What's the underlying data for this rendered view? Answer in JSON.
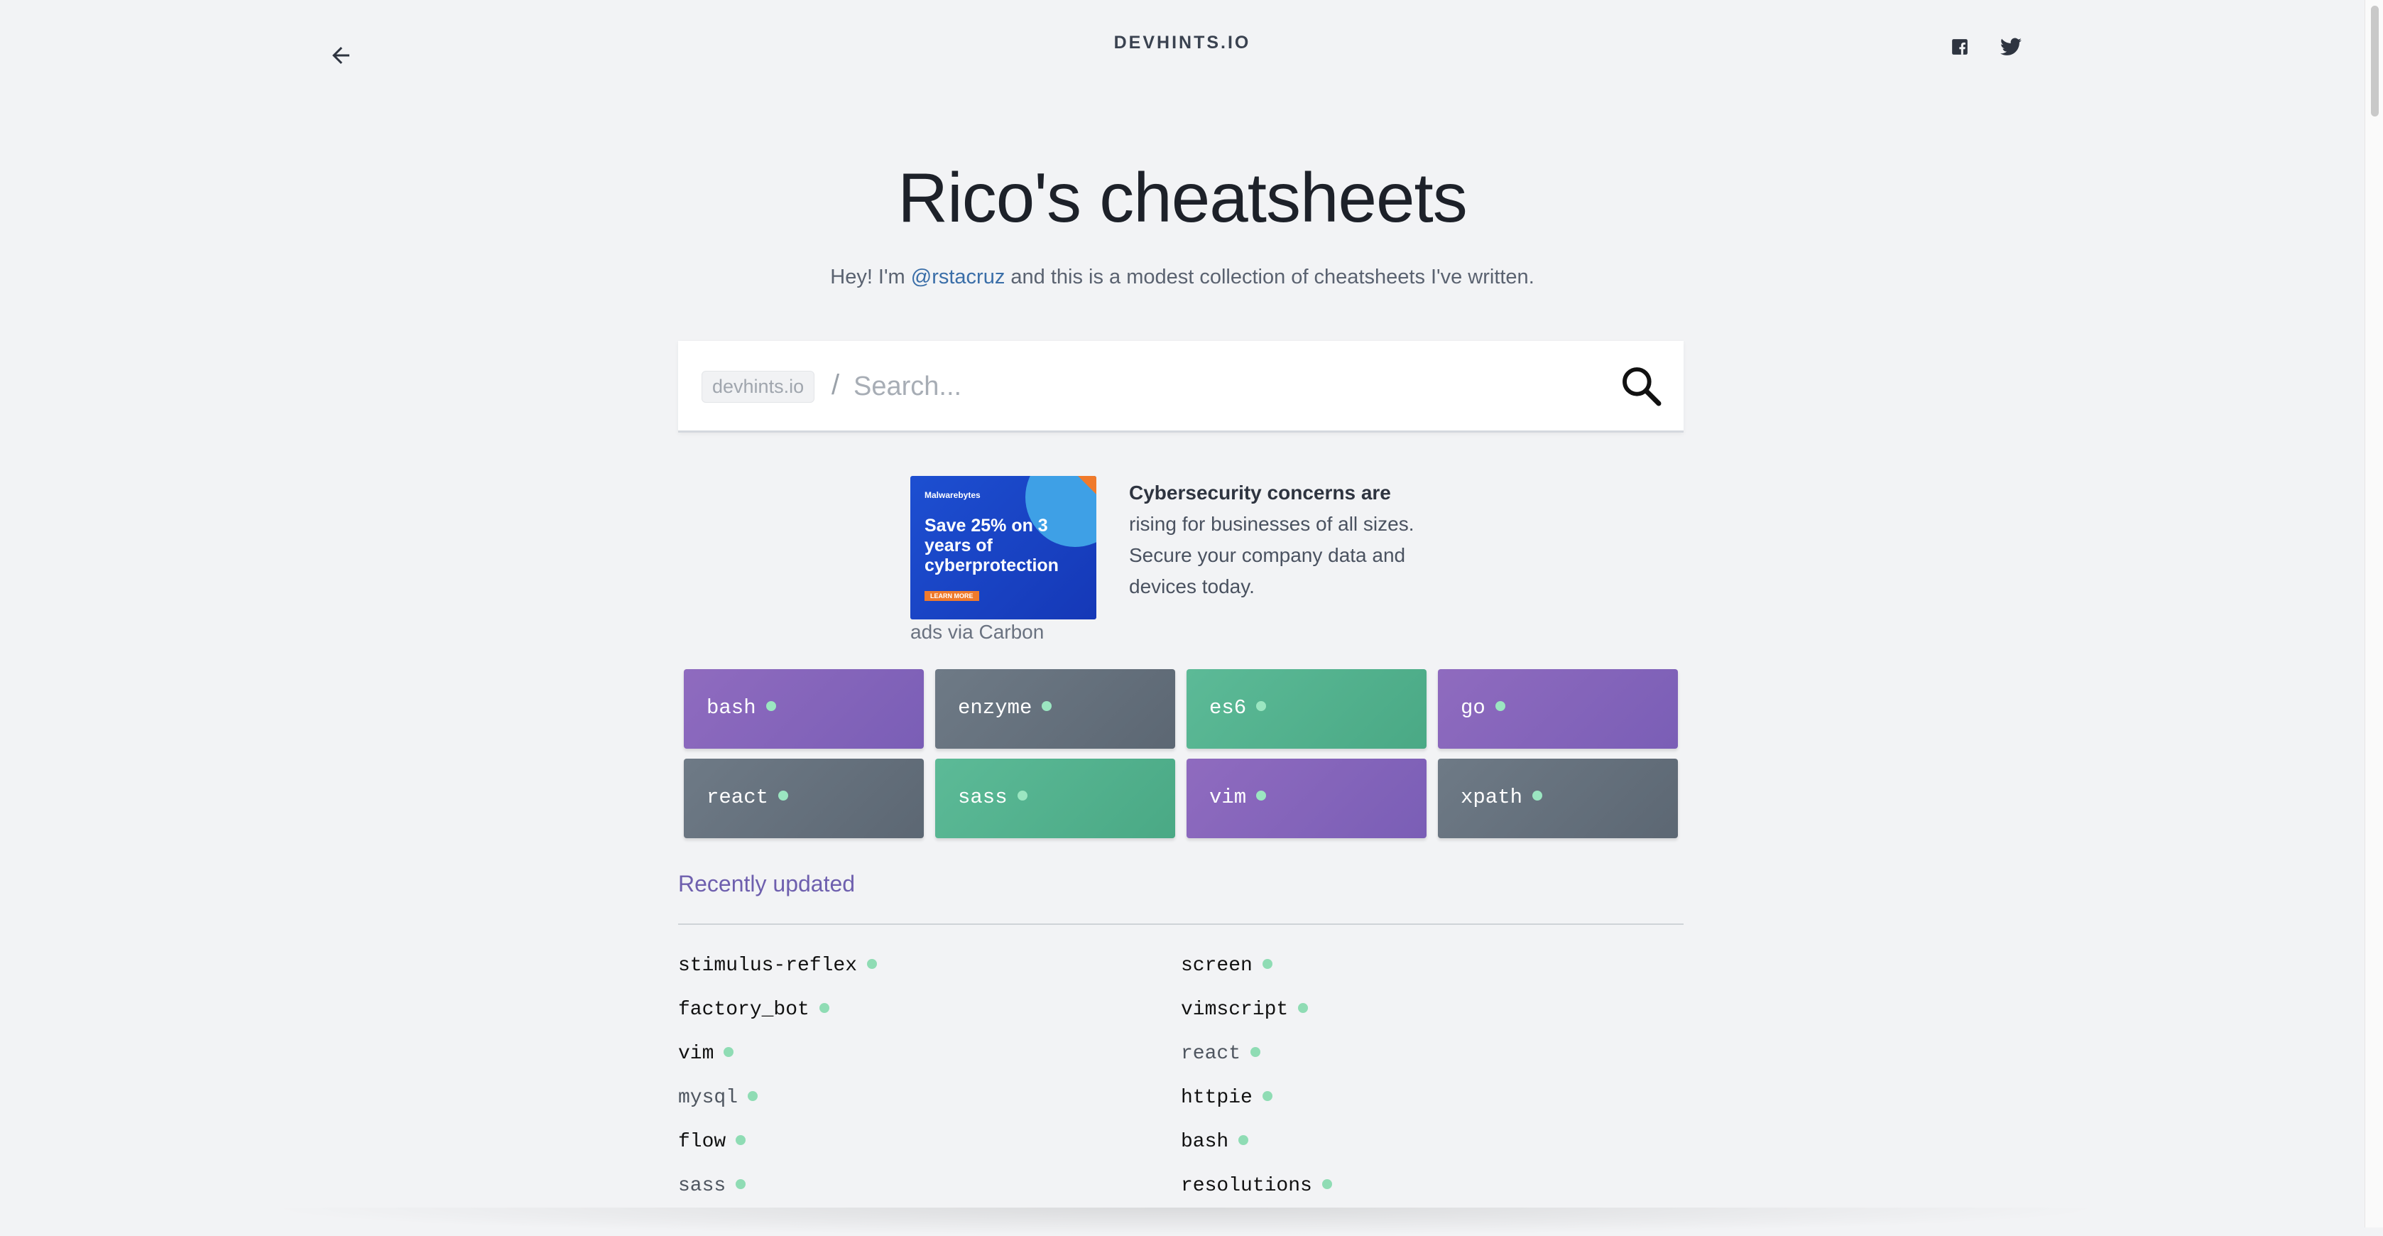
{
  "header": {
    "brand": "DEVHINTS.IO",
    "back_icon": "arrow-left-icon",
    "social": [
      {
        "name": "facebook",
        "icon": "facebook-icon"
      },
      {
        "name": "twitter",
        "icon": "twitter-icon"
      }
    ]
  },
  "hero": {
    "title": "Rico's cheatsheets",
    "sub_before": "Hey! I'm ",
    "sub_link": "@rstacruz",
    "sub_after": " and this is a modest collection of cheatsheets I've written."
  },
  "search": {
    "prefix": "devhints.io",
    "slash": "/",
    "placeholder": "Search...",
    "value": ""
  },
  "ad": {
    "brand": "Malwarebytes",
    "headline": "Save 25% on 3 years of cyberprotection",
    "cta": "LEARN MORE",
    "text_bold": "Cybersecurity concerns are",
    "text_rest": " rising for businesses of all sizes. Secure your company data and devices today.",
    "via": "ads via Carbon"
  },
  "tiles": [
    {
      "label": "bash",
      "color": "purple"
    },
    {
      "label": "enzyme",
      "color": "slate"
    },
    {
      "label": "es6",
      "color": "teal"
    },
    {
      "label": "go",
      "color": "purple"
    },
    {
      "label": "react",
      "color": "slate"
    },
    {
      "label": "sass",
      "color": "teal"
    },
    {
      "label": "vim",
      "color": "purple"
    },
    {
      "label": "xpath",
      "color": "slate"
    }
  ],
  "recent": {
    "title": "Recently updated",
    "left": [
      {
        "label": "stimulus-reflex",
        "muted": false
      },
      {
        "label": "factory_bot",
        "muted": false
      },
      {
        "label": "vim",
        "muted": false
      },
      {
        "label": "mysql",
        "muted": true
      },
      {
        "label": "flow",
        "muted": false
      },
      {
        "label": "sass",
        "muted": true
      }
    ],
    "right": [
      {
        "label": "screen",
        "muted": false
      },
      {
        "label": "vimscript",
        "muted": false
      },
      {
        "label": "react",
        "muted": true
      },
      {
        "label": "httpie",
        "muted": false
      },
      {
        "label": "bash",
        "muted": false
      },
      {
        "label": "resolutions",
        "muted": false
      }
    ]
  },
  "colors": {
    "background": "#f2f3f5",
    "link": "#3a6ea8",
    "recent_title": "#6e5fae",
    "tile_purple": "#8068b8",
    "tile_slate": "#65707c",
    "tile_teal": "#52b28e",
    "dot": "#8fdcb4"
  }
}
